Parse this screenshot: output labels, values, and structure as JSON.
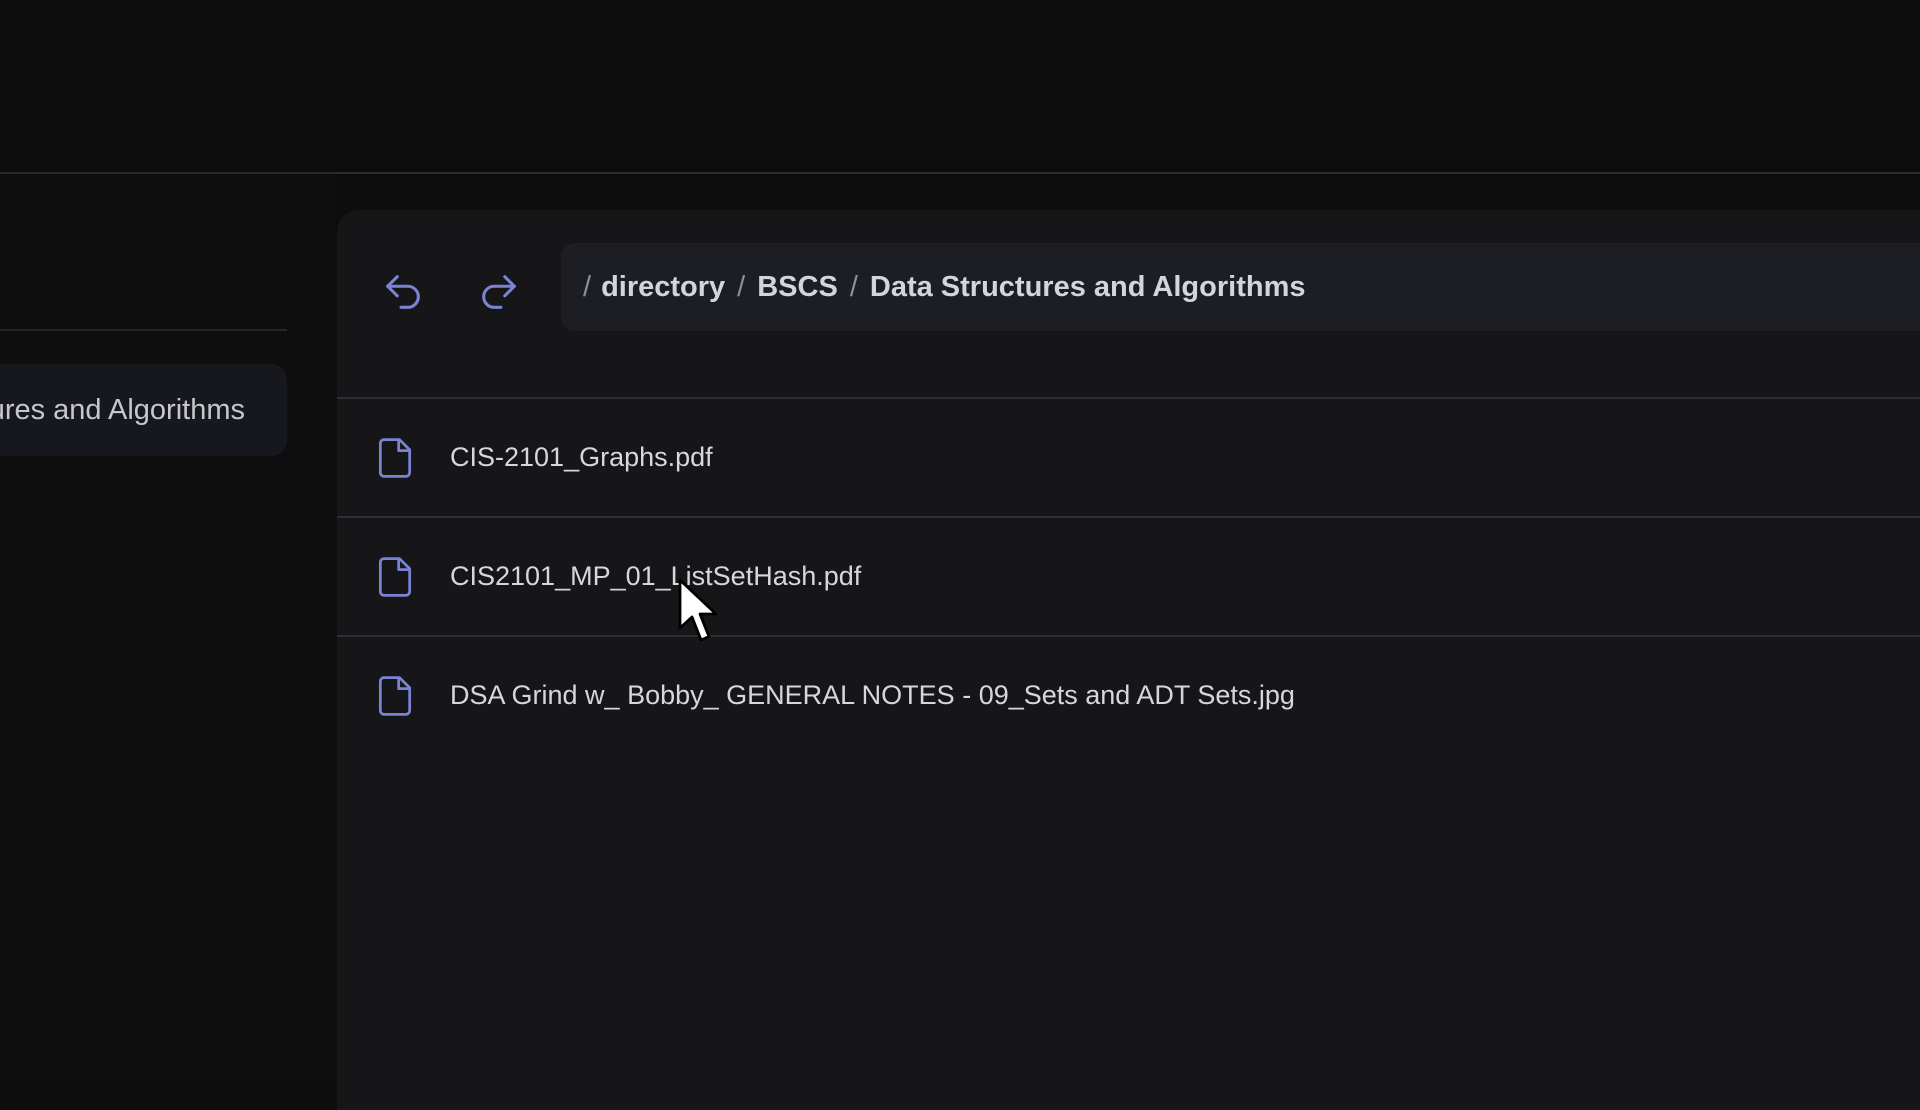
{
  "sidebar": {
    "active_item_label": "Data Structures and Algorithms"
  },
  "toolbar": {
    "back_icon": "undo-arrow-icon",
    "forward_icon": "redo-arrow-icon"
  },
  "breadcrumb": {
    "separator": "/",
    "items": [
      "directory",
      "BSCS",
      "Data Structures and Algorithms"
    ]
  },
  "files": [
    {
      "name": "CIS-2101_Graphs.pdf",
      "icon": "file-icon"
    },
    {
      "name": "CIS2101_MP_01_ListSetHash.pdf",
      "icon": "file-icon"
    },
    {
      "name": "DSA Grind w_ Bobby_ GENERAL NOTES - 09_Sets and ADT Sets.jpg",
      "icon": "file-icon"
    }
  ],
  "colors": {
    "background": "#0d0d0e",
    "panel": "#161618",
    "breadcrumb_bg": "#1d1e24",
    "accent_icon": "#7b83d4",
    "text": "#d6d7de"
  }
}
